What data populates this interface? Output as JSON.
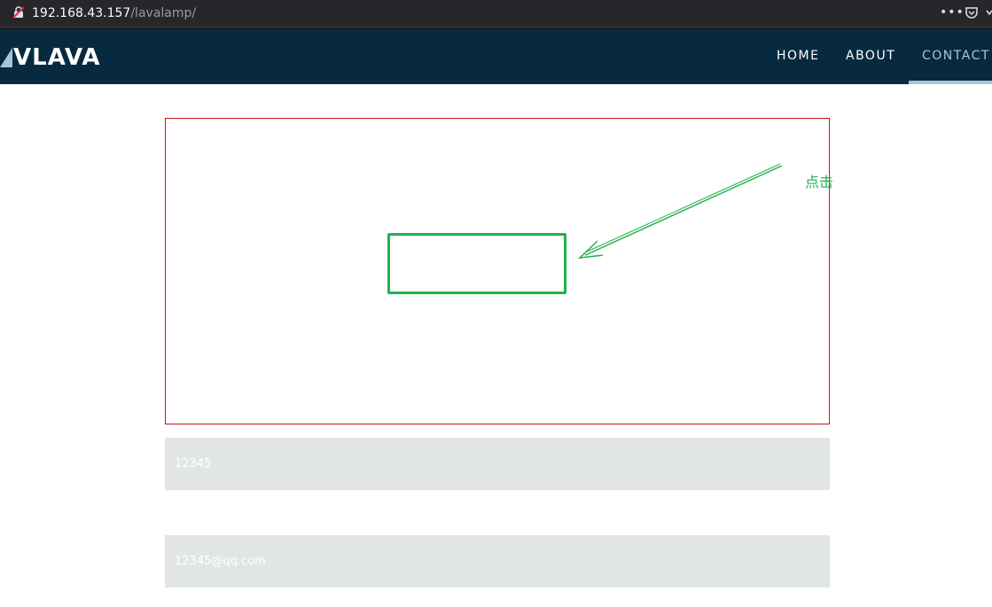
{
  "browser": {
    "url_host": "192.168.43.157",
    "url_path": "/lavalamp/",
    "icons": {
      "security": "insecure-lock-icon",
      "menu": "more-icon",
      "pocket": "pocket-icon",
      "overflow": "chevron-icon"
    }
  },
  "navbar": {
    "brand": "VLAVA",
    "brand_icon": "triangle-logo-icon",
    "links": [
      "HOME",
      "ABOUT",
      "CONTACT"
    ],
    "active_link": "CONTACT",
    "colors": {
      "background": "#072a40",
      "active": "#a7c5d3"
    }
  },
  "annotation": {
    "label": "点击",
    "color": "#22b14c"
  },
  "form": {
    "name_value": "12345",
    "email_value": "12345@qq.com"
  },
  "colors": {
    "frame_border": "#cc1122",
    "field_background": "#e2e6e3"
  }
}
